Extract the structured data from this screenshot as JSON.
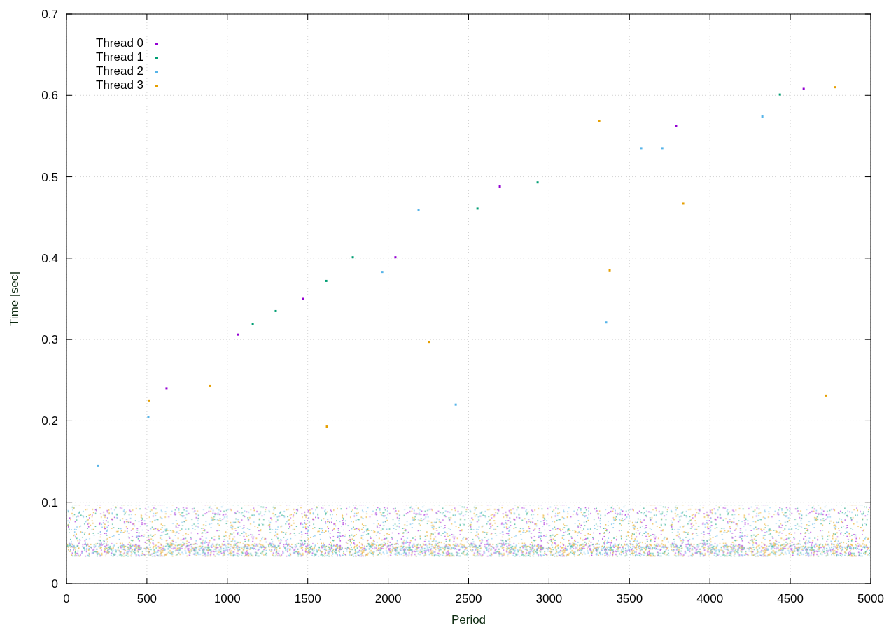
{
  "chart": {
    "chart_data": {
      "type": "scatter",
      "xlabel": "Period",
      "ylabel": "Time [sec]",
      "xlim": [
        0,
        5000
      ],
      "ylim": [
        0,
        0.7
      ],
      "grid": true,
      "legend": true,
      "bands": [
        {
          "axis": "y",
          "from": 0.033,
          "to": 0.096
        }
      ],
      "xticks": [
        0,
        500,
        1000,
        1500,
        2000,
        2500,
        3000,
        3500,
        4000,
        4500,
        5000
      ],
      "yticks": [
        {
          "value": 0,
          "label": "0"
        },
        {
          "value": 0.1,
          "label": "0.1"
        },
        {
          "value": 0.2,
          "label": "0.2"
        },
        {
          "value": 0.3,
          "label": "0.3"
        },
        {
          "value": 0.4,
          "label": "0.4"
        },
        {
          "value": 0.5,
          "label": "0.5"
        },
        {
          "value": 0.6,
          "label": "0.6"
        },
        {
          "value": 0.7,
          "label": "0.7"
        }
      ],
      "series": [
        {
          "name": "Thread 0",
          "color": "#9400d3",
          "x": [
            622,
            1066,
            1471,
            2045,
            2694,
            3790,
            4583
          ],
          "values": [
            0.24,
            0.306,
            0.35,
            0.401,
            0.488,
            0.562,
            0.608
          ]
        },
        {
          "name": "Thread 1",
          "color": "#009e73",
          "x": [
            1158,
            1301,
            1615,
            1780,
            2555,
            2929,
            4435
          ],
          "values": [
            0.319,
            0.335,
            0.372,
            0.401,
            0.461,
            0.493,
            0.601
          ]
        },
        {
          "name": "Thread 2",
          "color": "#56b4e9",
          "x": [
            196,
            509,
            1963,
            2189,
            2420,
            3355,
            3573,
            3704,
            4326
          ],
          "values": [
            0.145,
            0.205,
            0.383,
            0.459,
            0.22,
            0.321,
            0.535,
            0.535,
            0.574
          ]
        },
        {
          "name": "Thread 3",
          "color": "#e69f00",
          "x": [
            513,
            892,
            1619,
            2254,
            3312,
            3377,
            3834,
            4722,
            4780
          ],
          "values": [
            0.225,
            0.243,
            0.193,
            0.297,
            0.568,
            0.385,
            0.467,
            0.231,
            0.61
          ]
        }
      ]
    }
  }
}
